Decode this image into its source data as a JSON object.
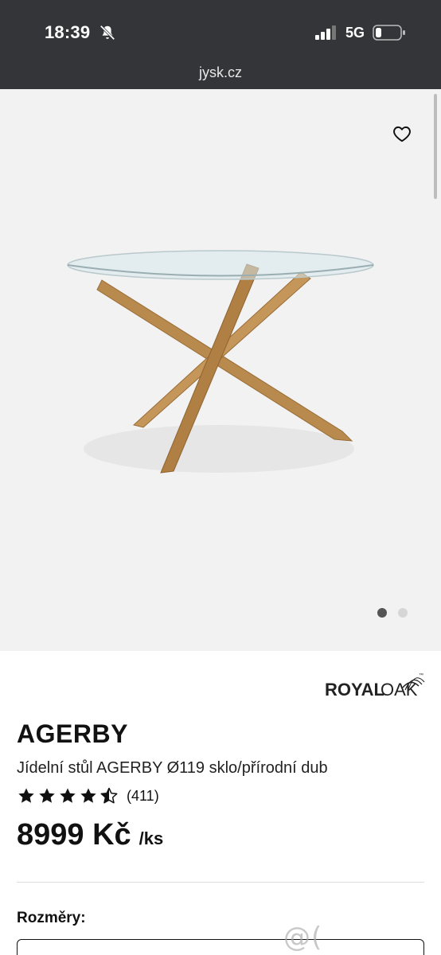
{
  "status_bar": {
    "time": "18:39",
    "network": "5G",
    "icons": [
      "bell-slash-icon",
      "signal-icon",
      "battery-icon"
    ]
  },
  "browser": {
    "url": "jysk.cz"
  },
  "gallery": {
    "slide_count": 2,
    "active_slide": 1
  },
  "product": {
    "brand": "ROYALOAK",
    "brand_parts": {
      "bold": "ROYAL",
      "light": "OAK"
    },
    "brand_mark": "™",
    "name": "AGERBY",
    "description": "Jídelní stůl AGERBY Ø119 sklo/přírodní dub",
    "rating": 4.5,
    "review_count": "(411)",
    "price": "8999 Kč",
    "price_unit": "/ks",
    "dimensions_label": "Rozměry:"
  },
  "watermark": "@( Bazos.cz",
  "colors": {
    "status_bar_bg": "#333538",
    "gallery_bg": "#f2f2f2",
    "wood": "#b98a4e",
    "text": "#111111"
  }
}
